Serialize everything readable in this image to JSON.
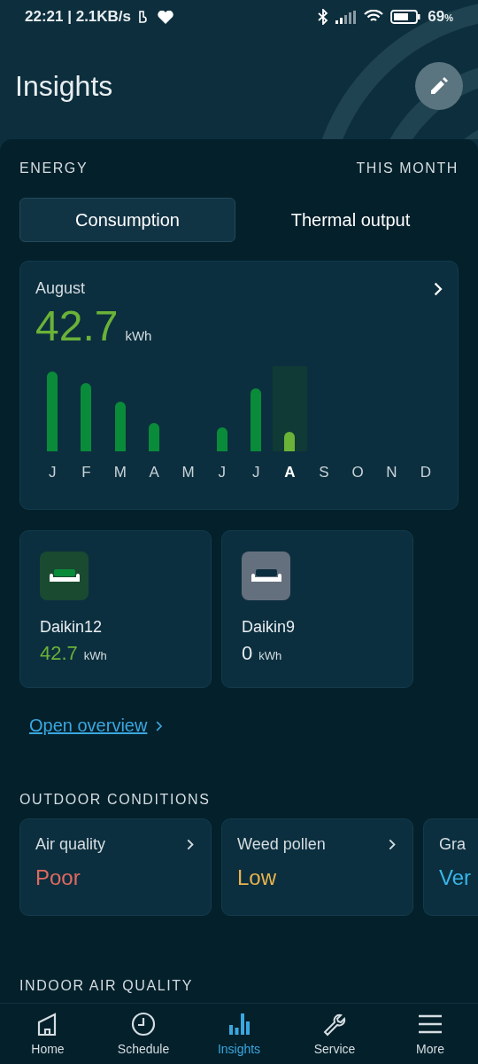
{
  "status_bar": {
    "time": "22:21 | 2.1KB/s",
    "battery": "69",
    "battery_unit": "%"
  },
  "header": {
    "title": "Insights"
  },
  "energy": {
    "heading": "ENERGY",
    "period": "THIS MONTH",
    "tabs": [
      {
        "label": "Consumption",
        "selected": true
      },
      {
        "label": "Thermal output",
        "selected": false
      }
    ],
    "summary": {
      "month": "August",
      "value": "42.7",
      "unit": "kWh"
    },
    "months": [
      {
        "label": "J",
        "selected": false
      },
      {
        "label": "F",
        "selected": false
      },
      {
        "label": "M",
        "selected": false
      },
      {
        "label": "A",
        "selected": false
      },
      {
        "label": "M",
        "selected": false
      },
      {
        "label": "J",
        "selected": false
      },
      {
        "label": "J",
        "selected": false
      },
      {
        "label": "A",
        "selected": true
      },
      {
        "label": "S",
        "selected": false
      },
      {
        "label": "O",
        "selected": false
      },
      {
        "label": "N",
        "selected": false
      },
      {
        "label": "D",
        "selected": false
      }
    ],
    "devices": [
      {
        "name": "Daikin12",
        "value": "42.7",
        "unit": "kWh",
        "on": true
      },
      {
        "name": "Daikin9",
        "value": "0",
        "unit": "kWh",
        "on": false
      }
    ],
    "link": "Open overview"
  },
  "outdoor": {
    "heading": "OUTDOOR CONDITIONS",
    "cards": [
      {
        "label": "Air quality",
        "value": "Poor",
        "color": "#e06a60"
      },
      {
        "label": "Weed pollen",
        "value": "Low",
        "color": "#e8b34e"
      },
      {
        "label": "Gra",
        "value": "Ver",
        "color": "#38b6e8"
      }
    ]
  },
  "indoor": {
    "heading": "INDOOR AIR QUALITY"
  },
  "nav": [
    {
      "label": "Home",
      "selected": false
    },
    {
      "label": "Schedule",
      "selected": false
    },
    {
      "label": "Insights",
      "selected": true
    },
    {
      "label": "Service",
      "selected": false
    },
    {
      "label": "More",
      "selected": false
    }
  ]
}
